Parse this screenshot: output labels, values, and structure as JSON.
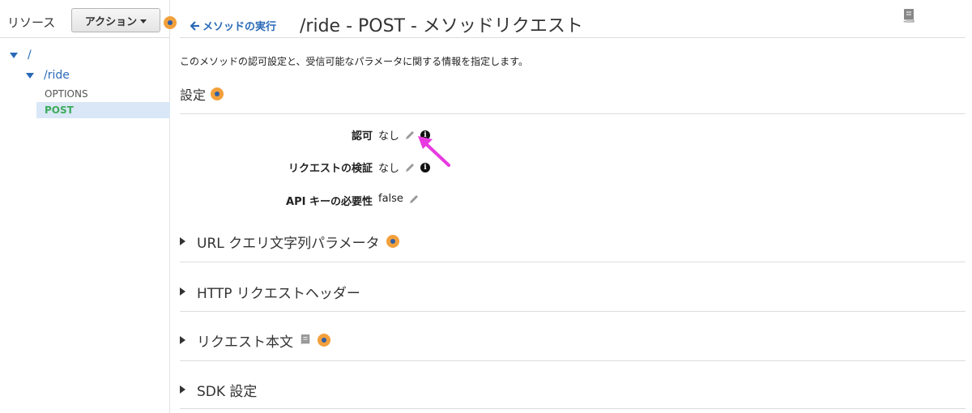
{
  "sidebar": {
    "title": "リソース",
    "action_button": "アクション",
    "tree": {
      "root": "/",
      "resource": "/ride",
      "methods": [
        "OPTIONS",
        "POST"
      ],
      "selected": "POST"
    }
  },
  "header": {
    "back_link": "メソッドの実行",
    "title": "/ride - POST - メソッドリクエスト"
  },
  "main": {
    "description": "このメソッドの認可設定と、受信可能なパラメータに関する情報を指定します。",
    "settings_title": "設定",
    "fields": [
      {
        "label": "認可",
        "value": "なし"
      },
      {
        "label": "リクエストの検証",
        "value": "なし"
      },
      {
        "label": "API キーの必要性",
        "value": "false"
      }
    ],
    "sections": [
      {
        "label": "URL クエリ文字列パラメータ"
      },
      {
        "label": "HTTP リクエストヘッダー"
      },
      {
        "label": "リクエスト本文"
      },
      {
        "label": "SDK 設定"
      }
    ]
  },
  "colors": {
    "link": "#2a6ab7",
    "selected_method": "#3cab5a",
    "help_badge": "#f2a03c",
    "annotation_arrow": "#e83ae0"
  }
}
